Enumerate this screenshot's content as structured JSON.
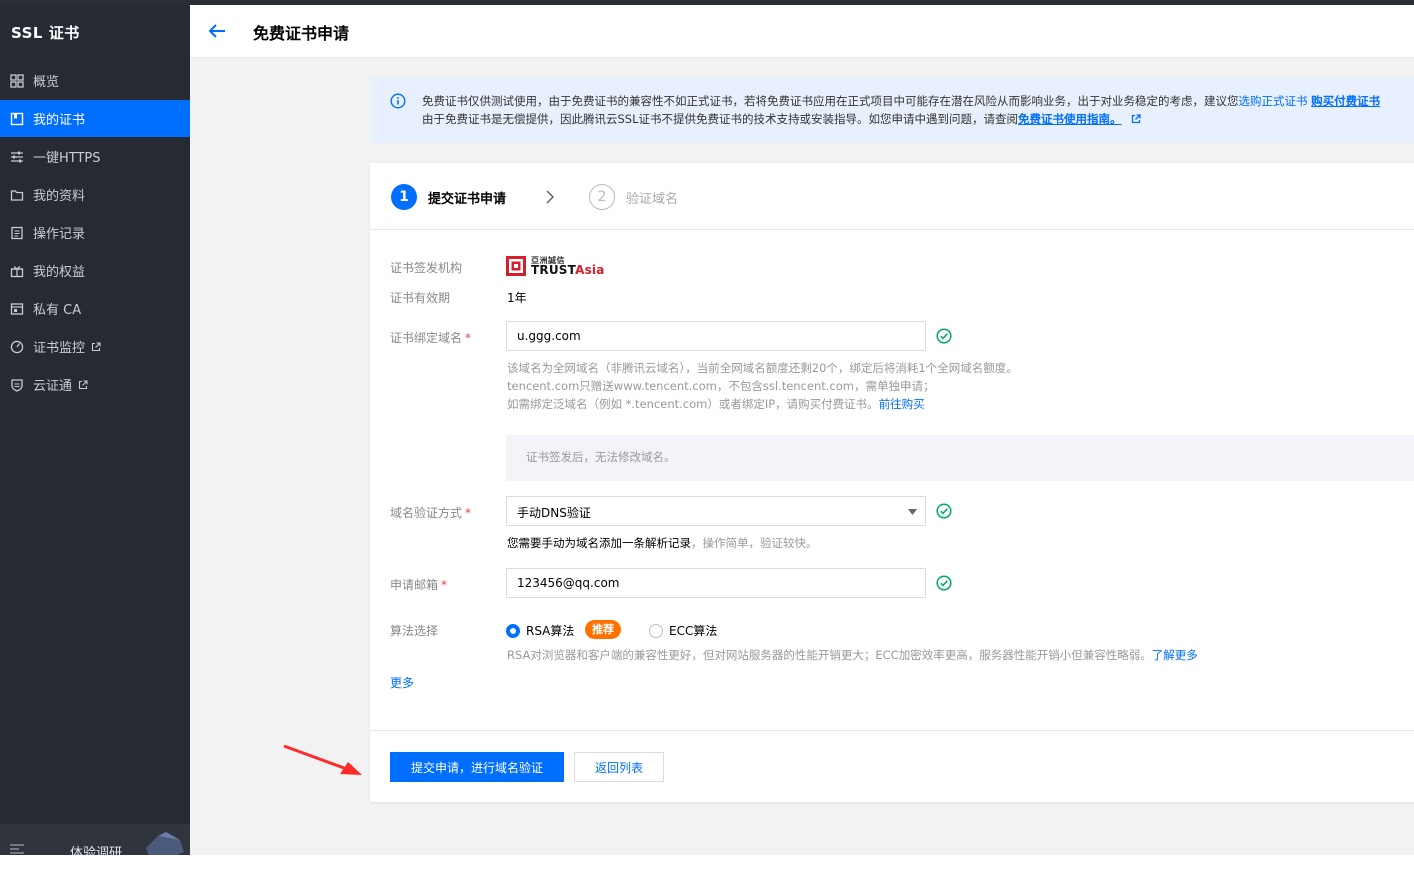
{
  "sidebar": {
    "title": "SSL 证书",
    "items": [
      {
        "label": "概览",
        "icon": "dashboard-icon"
      },
      {
        "label": "我的证书",
        "icon": "certificate-icon",
        "active": true
      },
      {
        "label": "一键HTTPS",
        "icon": "sliders-icon"
      },
      {
        "label": "我的资料",
        "icon": "folder-icon"
      },
      {
        "label": "操作记录",
        "icon": "log-icon"
      },
      {
        "label": "我的权益",
        "icon": "gift-icon"
      },
      {
        "label": "私有 CA",
        "icon": "ca-icon"
      },
      {
        "label": "证书监控",
        "icon": "monitor-icon",
        "external": true
      },
      {
        "label": "云证通",
        "icon": "shield-icon",
        "external": true
      }
    ],
    "footer_label": "体验调研"
  },
  "header": {
    "title": "免费证书申请"
  },
  "notice": {
    "line1_text": "免费证书仅供测试使用，由于免费证书的兼容性不如正式证书，若将免费证书应用在正式项目中可能存在潜在风险从而影响业务，出于对业务稳定的考虑，建议您",
    "line1_link": "选购正式证书",
    "line1_link2": "购买付费证书",
    "line2_text": "由于免费证书是无偿提供，因此腾讯云SSL证书不提供免费证书的技术支持或安装指导。如您申请中遇到问题，请查阅",
    "line2_link": "免费证书使用指南。"
  },
  "steps": [
    {
      "number": "1",
      "label": "提交证书申请"
    },
    {
      "number": "2",
      "label": "验证域名"
    }
  ],
  "form": {
    "issuer_label": "证书签发机构",
    "issuer_logo_small": "亞洲誠信",
    "issuer_logo_big_1": "TRUST",
    "issuer_logo_big_2": "A",
    "issuer_logo_big_3": "sia",
    "validity_label": "证书有效期",
    "validity_value": "1年",
    "domain_label": "证书绑定域名",
    "domain_value": "u.ggg.com",
    "domain_hint_1": "该域名为全网域名（非腾讯云域名），当前全网域名额度还剩20个，绑定后将消耗1个全网域名额度。",
    "domain_hint_2": "tencent.com只赠送www.tencent.com，不包含ssl.tencent.com，需单独申请；",
    "domain_hint_3": "如需绑定泛域名（例如 *.tencent.com）或者绑定IP，请购买付费证书。",
    "domain_hint_3_link": "前往购买",
    "domain_note": "证书签发后，无法修改域名。",
    "verify_label": "域名验证方式",
    "verify_value": "手动DNS验证",
    "verify_hint_dark": "您需要手动为域名添加一条解析记录",
    "verify_hint_light": "，操作简单，验证较快。",
    "email_label": "申请邮箱",
    "email_value": "123456@qq.com",
    "algo_label": "算法选择",
    "algo_rsa": "RSA算法",
    "algo_badge": "推荐",
    "algo_ecc": "ECC算法",
    "algo_hint": "RSA对浏览器和客户端的兼容性更好，但对网站服务器的性能开销更大；ECC加密效率更高，服务器性能开销小但兼容性略弱。",
    "algo_hint_link": "了解更多",
    "more_label": "更多"
  },
  "actions": {
    "submit_label": "提交申请，进行域名验证",
    "back_label": "返回列表"
  },
  "colors": {
    "accent": "#006eff",
    "sidebar_bg": "#262a33",
    "success": "#00a870",
    "badge": "#ff7200",
    "annotation_arrow": "#ff2a2a"
  }
}
